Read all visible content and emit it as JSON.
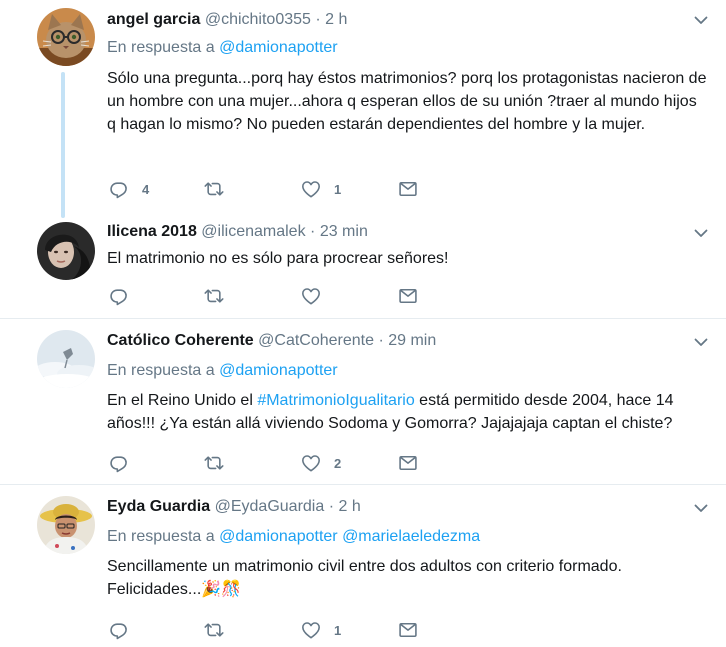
{
  "colors": {
    "link": "#1da1f2",
    "muted": "#657786",
    "text": "#14171a",
    "thread": "#c4e2f6",
    "divider": "#e6ecf0"
  },
  "icons": [
    "reply-icon",
    "retweet-icon",
    "like-icon",
    "direct-message-icon",
    "chevron-down-icon"
  ],
  "tweets": [
    {
      "name": "angel garcia",
      "handle": "@chichito0355",
      "dot": "·",
      "time": "2 h",
      "reply_prefix": "En respuesta a",
      "mentions": [
        "@damionapotter"
      ],
      "text": "Sólo una pregunta...porq hay éstos matrimonios?  porq los protagonistas nacieron de un hombre con una mujer...ahora q esperan ellos de su unión ?traer al mundo hijos q hagan lo mismo? No pueden estarán dependientes del hombre y la mujer.",
      "replies": "4",
      "retweets": "",
      "likes": "1"
    },
    {
      "name": "Ilicena 2018",
      "handle": "@ilicenamalek",
      "dot": "·",
      "time": "23 min",
      "text": "El matrimonio no es sólo para procrear señores!",
      "replies": "",
      "retweets": "",
      "likes": ""
    },
    {
      "name": "Católico Coherente",
      "handle": "@CatCoherente",
      "dot": "·",
      "time": "29 min",
      "reply_prefix": "En respuesta a",
      "mentions": [
        "@damionapotter"
      ],
      "text_before": "En el Reino Unido el ",
      "hashtag": "#MatrimonioIgualitario",
      "text_after": " está permitido desde 2004, hace 14 años!!!  ¿Ya están allá viviendo Sodoma y Gomorra?     Jajajajaja captan el chiste?",
      "replies": "",
      "retweets": "",
      "likes": "2"
    },
    {
      "name": "Eyda Guardia",
      "handle": "@EydaGuardia",
      "dot": "·",
      "time": "2 h",
      "reply_prefix": "En respuesta a",
      "mentions": [
        "@damionapotter",
        "@marielaeledezma"
      ],
      "text": "Sencillamente un matrimonio civil entre dos adultos con criterio formado. Felicidades...🎉🎊",
      "replies": "",
      "retweets": "",
      "likes": "1"
    }
  ]
}
